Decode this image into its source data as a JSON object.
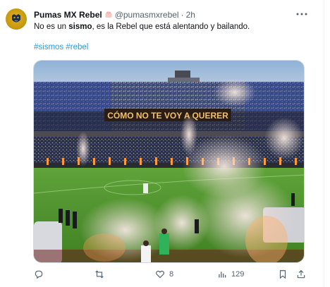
{
  "post": {
    "author_name": "Pumas MX Rebel",
    "handle": "@pumasmxrebel",
    "separator": "·",
    "time": "2h",
    "text_before": "No es un ",
    "text_bold": "sismo",
    "text_after": ", es la Rebel que está alentando y bailando.",
    "hashtags": [
      "#sismos",
      "#rebel"
    ],
    "media": {
      "banner_text": "CÓMO NO TE VOY A QUERER"
    }
  },
  "actions": {
    "replies": "",
    "reposts": "",
    "likes": "8",
    "views": "129"
  },
  "icons": {
    "avatar": "pumas-logo-icon",
    "badge": "verified-badge-icon",
    "more": "more-options-icon",
    "reply": "reply-icon",
    "repost": "repost-icon",
    "like": "like-icon",
    "views": "views-icon",
    "share": "share-icon"
  },
  "colors": {
    "link": "#1d9bf0",
    "secondary_text": "#536471",
    "avatar_gold": "#d4a514"
  }
}
